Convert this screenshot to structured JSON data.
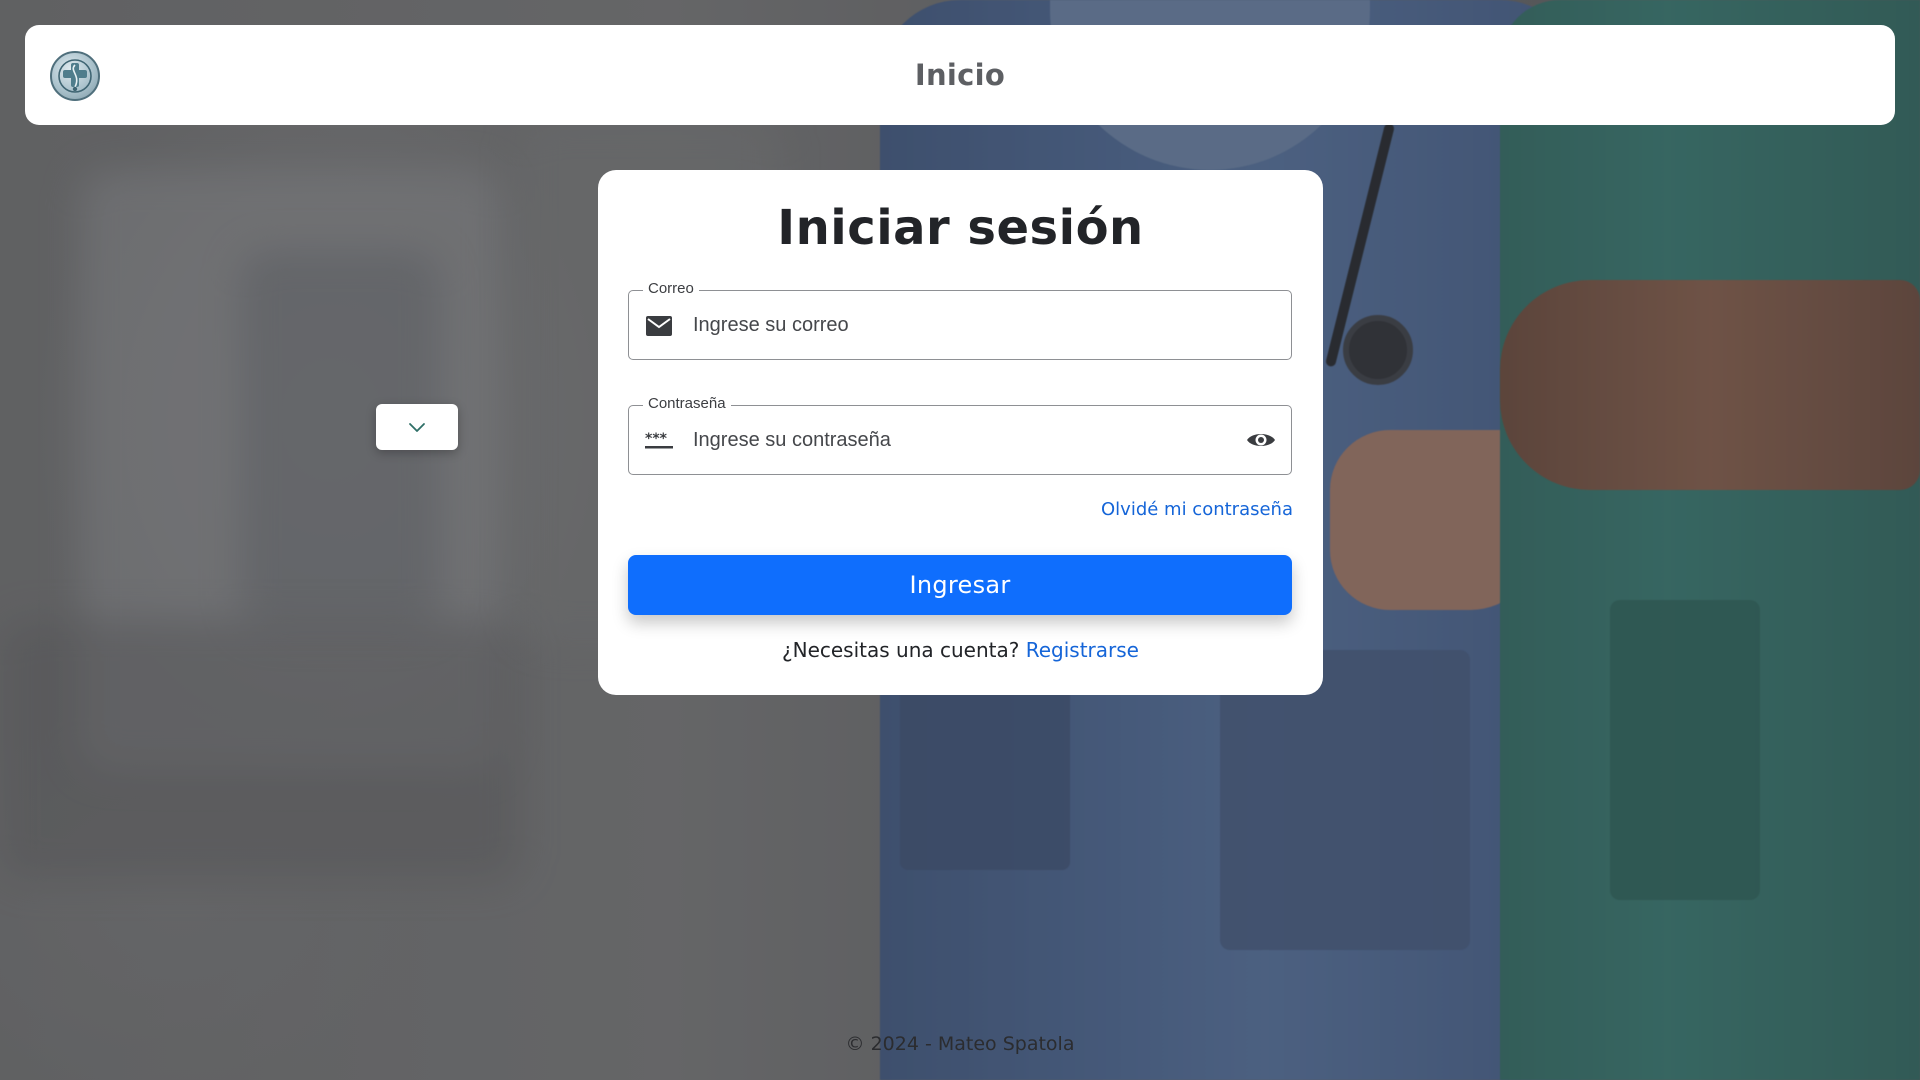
{
  "header": {
    "title": "Inicio"
  },
  "login": {
    "title": "Iniciar sesión",
    "email": {
      "legend": "Correo",
      "placeholder": "Ingrese su correo"
    },
    "password": {
      "legend": "Contraseña",
      "placeholder": "Ingrese su contraseña"
    },
    "forgot_label": "Olvidé mi contraseña",
    "submit_label": "Ingresar",
    "register_prompt": "¿Necesitas una cuenta?",
    "register_label": "Registrarse"
  },
  "footer": {
    "text": "© 2024 - Mateo Spatola"
  },
  "icons": {
    "logo": "medical-cross-icon",
    "dropdown": "chevron-down-icon",
    "email": "envelope-icon",
    "password": "password-dots-icon",
    "eye": "eye-icon"
  },
  "colors": {
    "primary": "#0f6efd",
    "link": "#1565d8",
    "card": "#ffffff",
    "title": "#222428"
  }
}
